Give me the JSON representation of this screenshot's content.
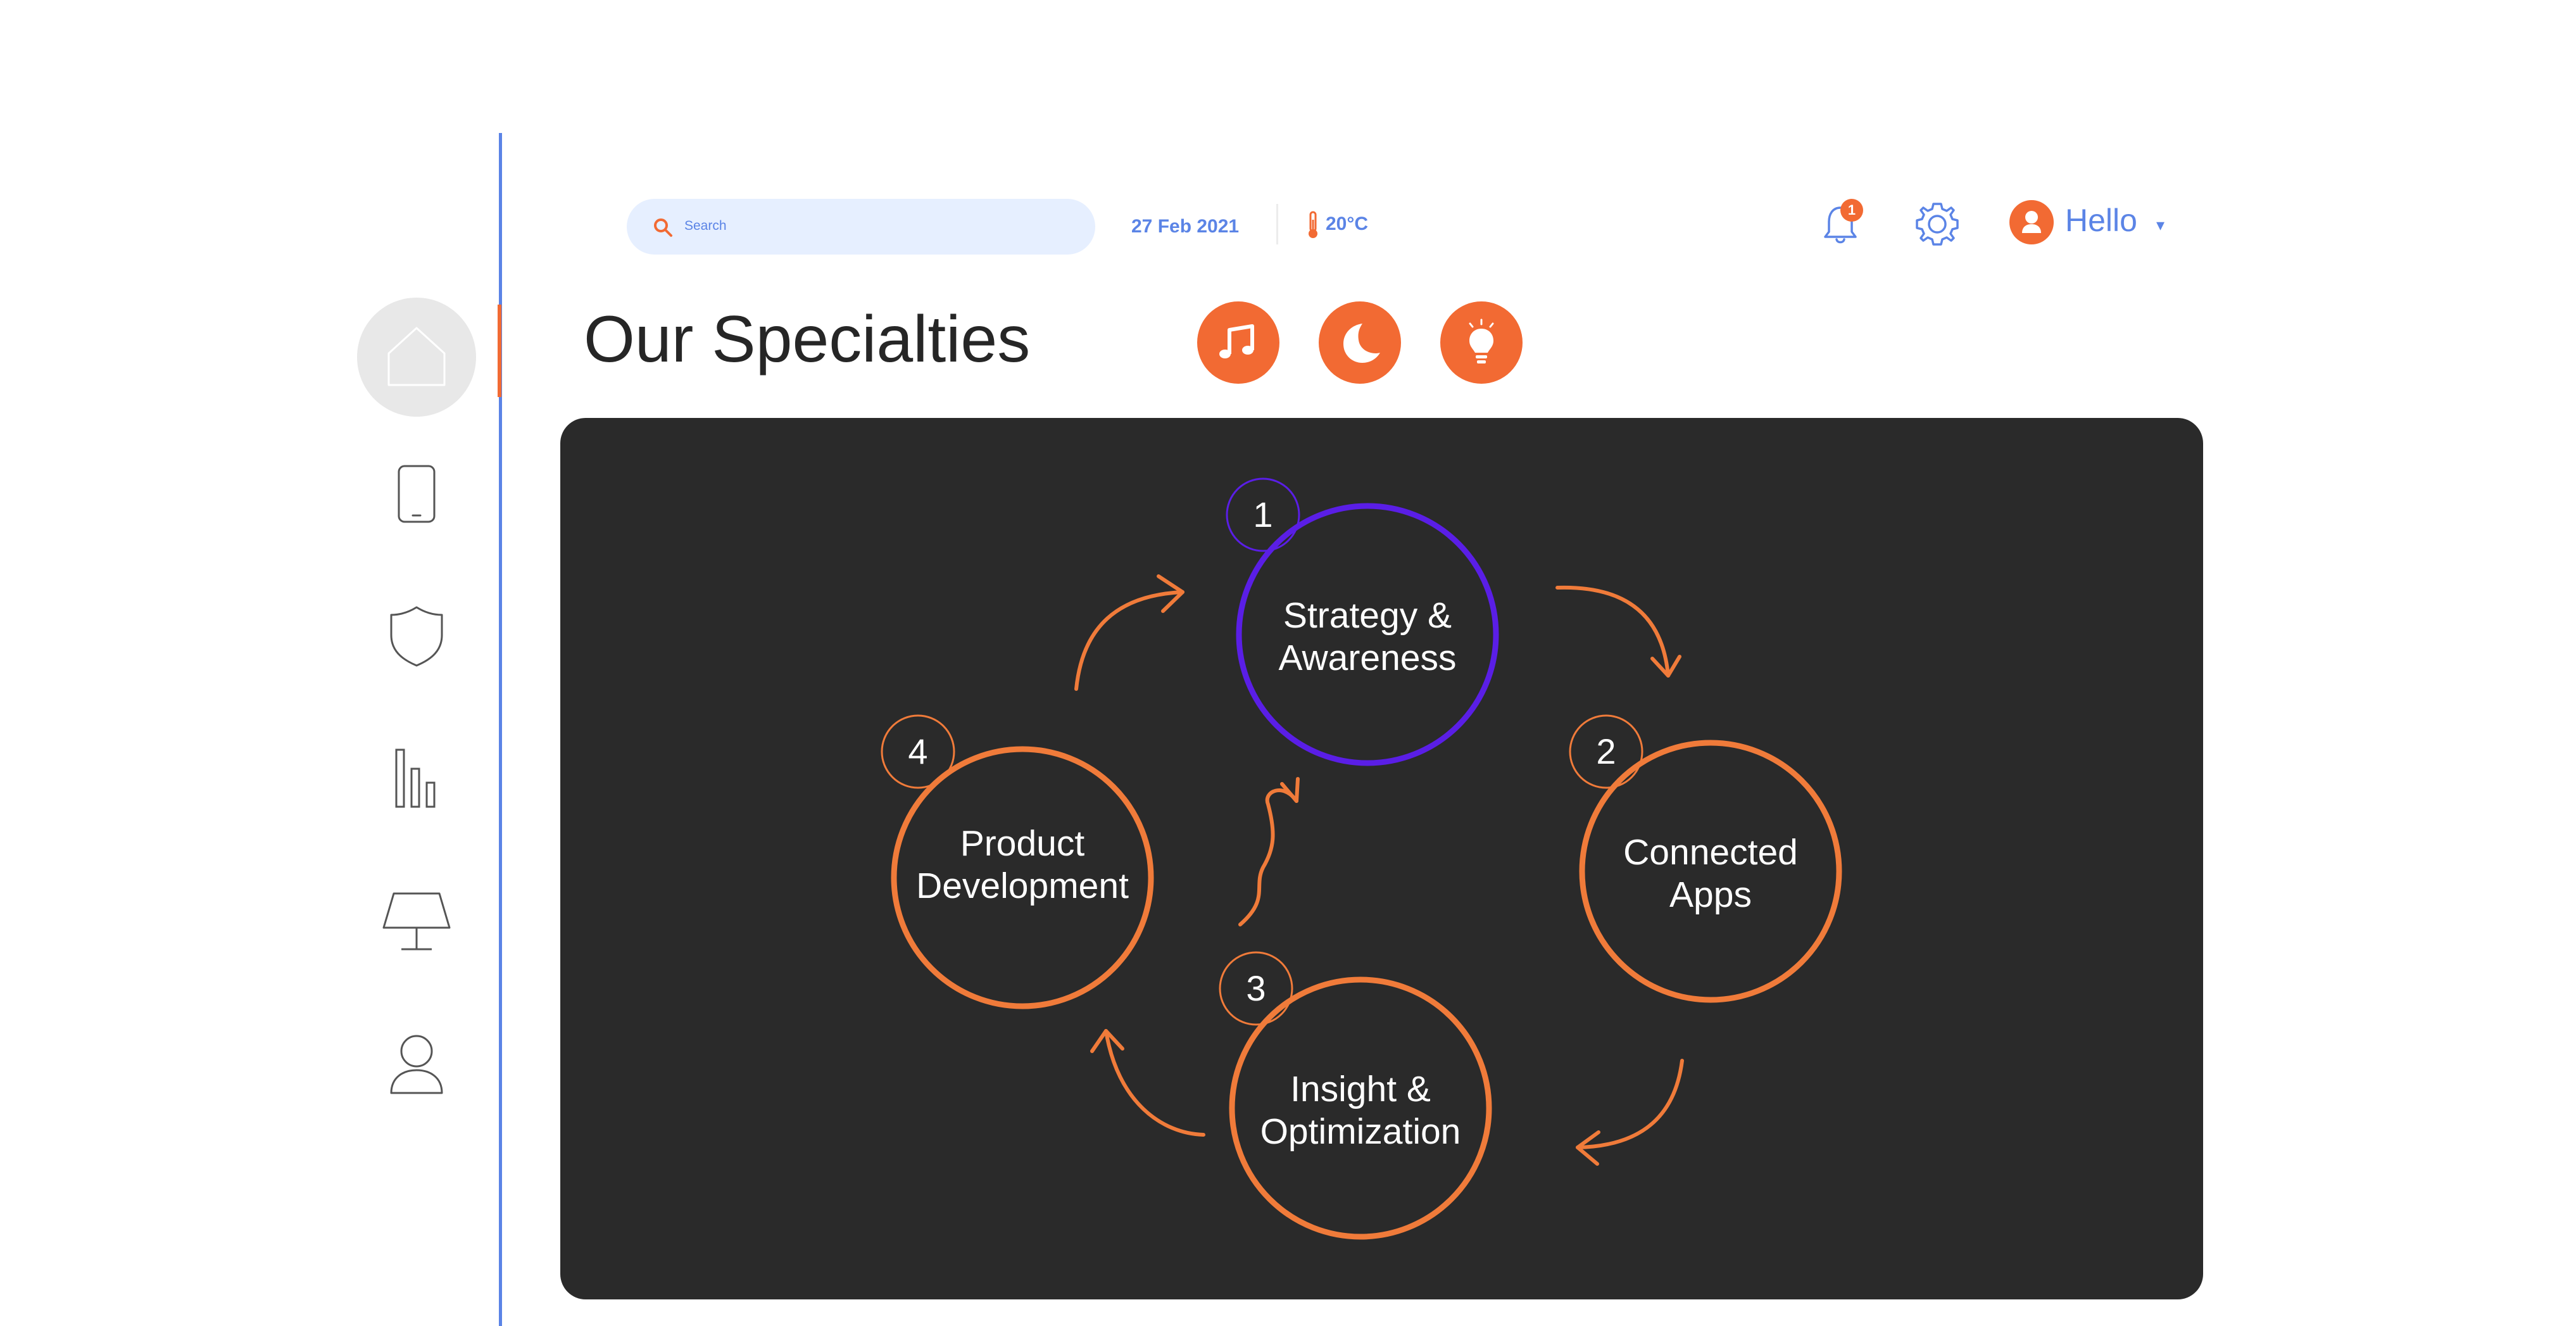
{
  "header": {
    "search_placeholder": "Search",
    "date": "27 Feb 2021",
    "temperature": "20°C",
    "notifications_count": "1",
    "greeting": "Hello",
    "caret": "▾"
  },
  "page": {
    "title": "Our Specialties"
  },
  "sidebar": {
    "items": [
      {
        "icon": "home-icon",
        "active": true
      },
      {
        "icon": "phone-icon",
        "active": false
      },
      {
        "icon": "shield-icon",
        "active": false
      },
      {
        "icon": "bar-chart-icon",
        "active": false
      },
      {
        "icon": "desk-icon",
        "active": false
      },
      {
        "icon": "user-icon",
        "active": false
      }
    ]
  },
  "quick_actions": [
    {
      "icon": "music-icon"
    },
    {
      "icon": "moon-icon"
    },
    {
      "icon": "lightbulb-icon"
    }
  ],
  "cycle": {
    "steps": [
      {
        "number": "1",
        "line1": "Strategy &",
        "line2": "Awareness",
        "color": "#5a1ee6"
      },
      {
        "number": "2",
        "line1": "Connected",
        "line2": "Apps",
        "color": "#f07b3a"
      },
      {
        "number": "3",
        "line1": "Insight &",
        "line2": "Optimization",
        "color": "#f07b3a"
      },
      {
        "number": "4",
        "line1": "Product",
        "line2": "Development",
        "color": "#f07b3a"
      }
    ]
  },
  "colors": {
    "accent": "#f26a33",
    "blue": "#5b84e6",
    "purple": "#5a1ee6",
    "panel": "#2a2a2a",
    "search_bg": "#e6efff"
  }
}
